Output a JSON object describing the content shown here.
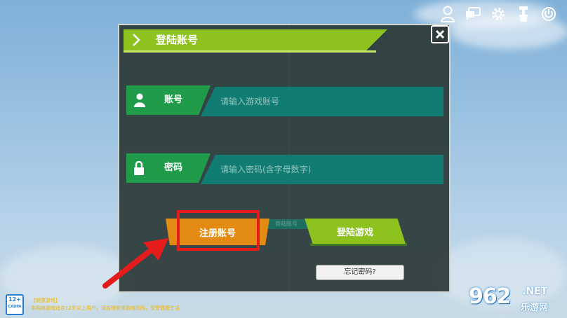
{
  "header": {
    "title": "登陆账号"
  },
  "account": {
    "label": "账号",
    "placeholder": "请输入游戏账号"
  },
  "password": {
    "label": "密码",
    "placeholder": "请输入密码(含字母数字)"
  },
  "buttons": {
    "register": "注册账号",
    "login": "登陆游戏",
    "forgot": "忘记密码?",
    "hidden_tab": "登陆账号"
  },
  "age_badge": {
    "line1": "12+",
    "line2": "CADPA"
  },
  "notice": {
    "line1": "【健康游戏】",
    "line2": "本网络游戏适合12岁以上用户，请合理安排游戏时间，享受健康生活"
  },
  "watermark": {
    "main": "962",
    "net": ".NET",
    "sub": "乐游网"
  },
  "topbar_icons": [
    "user-icon",
    "chat-icon",
    "gear-icon",
    "broom-icon",
    "power-icon"
  ],
  "colors": {
    "accent_green": "#8dc21f",
    "field_green": "#1f9b4a",
    "input_teal": "#117c72",
    "register_orange": "#e28a12",
    "highlight_red": "#e51c1c"
  }
}
